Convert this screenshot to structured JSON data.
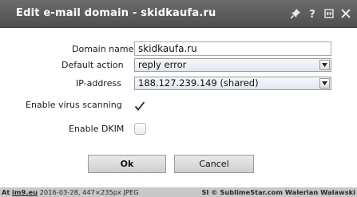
{
  "dialog": {
    "title": "Edit e-mail domain - skidkaufa.ru",
    "title_icons": [
      "pin-icon",
      "help-icon",
      "maximize-icon",
      "close-icon"
    ]
  },
  "form": {
    "domain_name": {
      "label": "Domain name",
      "value": "skidkaufa.ru"
    },
    "default_action": {
      "label": "Default action",
      "value": "reply error"
    },
    "ip_address": {
      "label": "IP-address",
      "value": "188.127.239.149 (shared)"
    },
    "virus_scanning": {
      "label": "Enable virus scanning",
      "checked": true
    },
    "dkim": {
      "label": "Enable DKIM",
      "checked": false
    }
  },
  "buttons": {
    "ok": "Ok",
    "cancel": "Cancel"
  },
  "watermark": {
    "prefix": "At",
    "site": "im9.eu",
    "details": "2016-03-28, 447×235px JPEG",
    "right_prefix": "SI",
    "right_text": "© SublimeStar.com Walerian Walawski"
  },
  "colors": {
    "titlebar": "#5d5d5d",
    "button": "#dcdcdc",
    "select": "#e8ecf3",
    "footer": "#c8c8c8"
  }
}
